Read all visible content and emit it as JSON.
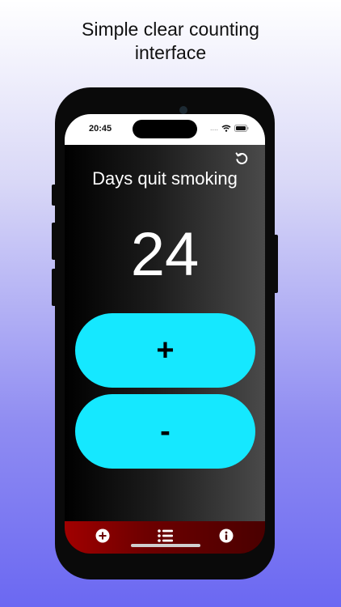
{
  "headline": {
    "line1": "Simple clear counting",
    "line2": "interface"
  },
  "status_bar": {
    "time": "20:45",
    "dots": "....",
    "icons": [
      "wifi-icon",
      "battery-icon"
    ]
  },
  "counter": {
    "title": "Days quit smoking",
    "value": "24",
    "increment_label": "+",
    "decrement_label": "-"
  },
  "toolbar": {
    "reset_icon": "reset-icon"
  },
  "tab_bar": {
    "items": [
      {
        "icon": "add-circle-icon"
      },
      {
        "icon": "list-icon"
      },
      {
        "icon": "info-icon"
      }
    ]
  },
  "colors": {
    "button": "#15e8ff",
    "tab_bar": "#a10000",
    "background_top": "#ffffff",
    "background_bottom": "#6b68f2"
  }
}
